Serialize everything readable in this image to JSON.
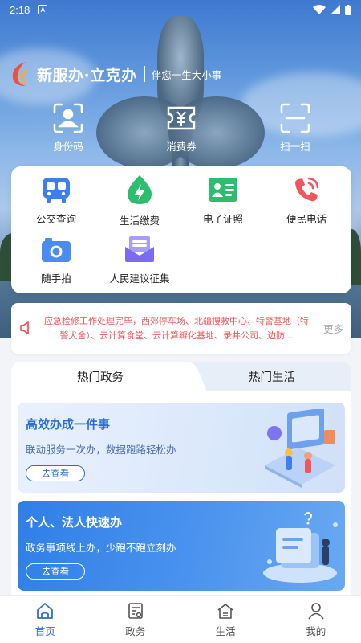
{
  "status_bar": {
    "time": "2:18",
    "badge": "A"
  },
  "brand": {
    "name": "新服办·立克办",
    "slogan": "伴您一生大小事"
  },
  "quick_actions": [
    {
      "label": "身份码",
      "icon": "id-code-icon"
    },
    {
      "label": "消费券",
      "icon": "coupon-icon"
    },
    {
      "label": "扫一扫",
      "icon": "scan-icon"
    }
  ],
  "services": [
    {
      "label": "公交查询",
      "icon": "bus-icon",
      "color": "#3d7ef0"
    },
    {
      "label": "生活缴费",
      "icon": "bolt-drop-icon",
      "color": "#2dbd6e"
    },
    {
      "label": "电子证照",
      "icon": "id-card-icon",
      "color": "#2dbd6e"
    },
    {
      "label": "便民电话",
      "icon": "phone-icon",
      "color": "#f2565a"
    },
    {
      "label": "随手拍",
      "icon": "camera-icon",
      "color": "#4a8cf2"
    },
    {
      "label": "人民建议征集",
      "icon": "mail-icon",
      "color": "#7a6cf0"
    }
  ],
  "notice": {
    "text": "应急检修工作处理完毕，西郊停车场、北疆搜救中心、特警基地（特警犬舍）、云计算食堂、云计算孵化基地、录井公司、边防...",
    "more": "更多"
  },
  "tabs": [
    {
      "label": "热门政务",
      "active": true
    },
    {
      "label": "热门生活",
      "active": false
    }
  ],
  "promos": [
    {
      "title": "高效办成一件事",
      "subtitle": "联动服务一次办，数据跑路轻松办",
      "button": "去查看"
    },
    {
      "title": "个人、法人快速办",
      "subtitle": "政务事项线上办，少跑不跑立刻办",
      "button": "去查看"
    }
  ],
  "nav": [
    {
      "label": "首页",
      "icon": "home-icon",
      "active": true
    },
    {
      "label": "政务",
      "icon": "document-icon",
      "active": false
    },
    {
      "label": "生活",
      "icon": "life-icon",
      "active": false
    },
    {
      "label": "我的",
      "icon": "user-icon",
      "active": false
    }
  ],
  "colors": {
    "accent": "#2a6fd6",
    "notice": "#f2565a"
  }
}
